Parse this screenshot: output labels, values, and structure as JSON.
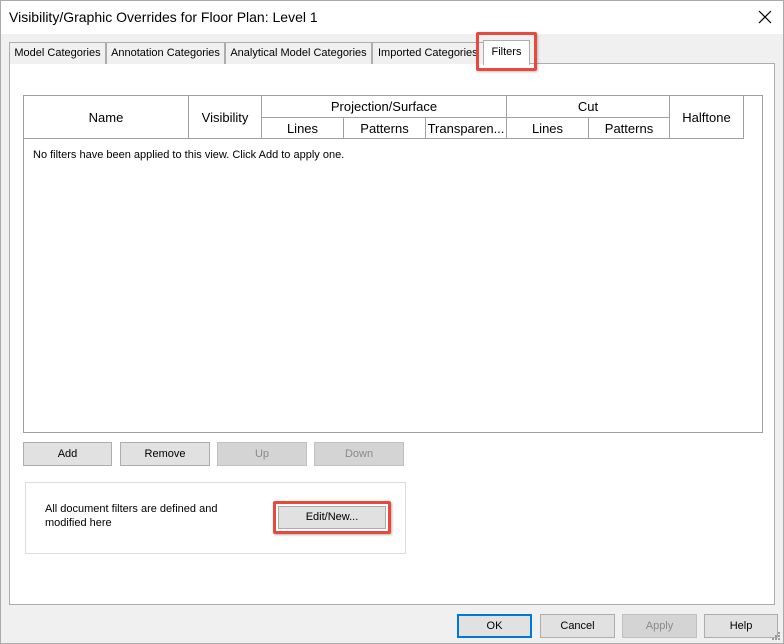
{
  "window": {
    "title": "Visibility/Graphic Overrides for Floor Plan: Level 1"
  },
  "tabs": [
    {
      "label": "Model Categories"
    },
    {
      "label": "Annotation Categories"
    },
    {
      "label": "Analytical Model Categories"
    },
    {
      "label": "Imported Categories"
    },
    {
      "label": "Filters",
      "active": true
    }
  ],
  "grid": {
    "headers": {
      "name": "Name",
      "visibility": "Visibility",
      "projection_surface": "Projection/Surface",
      "proj_lines": "Lines",
      "proj_patterns": "Patterns",
      "proj_transparency": "Transparen...",
      "cut": "Cut",
      "cut_lines": "Lines",
      "cut_patterns": "Patterns",
      "halftone": "Halftone"
    },
    "empty_message": "No filters have been applied to this view. Click Add to apply one."
  },
  "filter_buttons": {
    "add": "Add",
    "remove": "Remove",
    "up": "Up",
    "down": "Down"
  },
  "filters_group": {
    "text": "All document filters are defined and modified here",
    "edit_new": "Edit/New..."
  },
  "dialog_buttons": {
    "ok": "OK",
    "cancel": "Cancel",
    "apply": "Apply",
    "help": "Help"
  },
  "colors": {
    "highlight": "#e8493d",
    "default_button_border": "#0078d7"
  },
  "icons": {
    "close": "close-icon",
    "resize": "resize-grip-icon"
  }
}
